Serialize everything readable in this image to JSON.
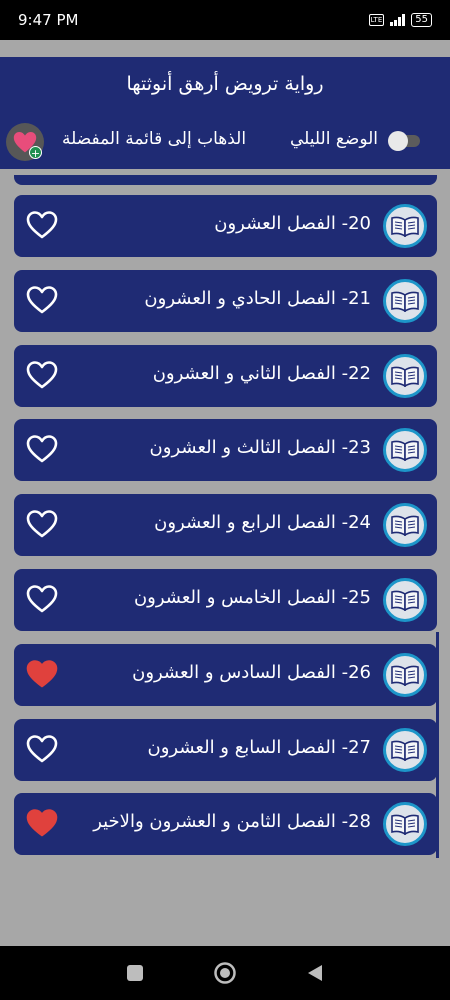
{
  "status_bar": {
    "time": "9:47 PM",
    "battery": "55",
    "network": "LTE"
  },
  "header": {
    "title": "رواية ترويض أرهق أنوثتها",
    "night_mode_label": "الوضع الليلي",
    "favorites_label": "الذهاب إلى قائمة المفضلة",
    "night_mode_on": false
  },
  "chapters": [
    {
      "label": "20- الفصل العشرون",
      "favorite": false
    },
    {
      "label": "21- الفصل الحادي و العشرون",
      "favorite": false
    },
    {
      "label": "22- الفصل الثاني و العشرون",
      "favorite": false
    },
    {
      "label": "23- الفصل الثالث و العشرون",
      "favorite": false
    },
    {
      "label": "24- الفصل الرابع و العشرون",
      "favorite": false
    },
    {
      "label": "25- الفصل الخامس و العشرون",
      "favorite": false
    },
    {
      "label": "26- الفصل السادس و العشرون",
      "favorite": true
    },
    {
      "label": "27- الفصل السابع و العشرون",
      "favorite": false
    },
    {
      "label": "28- الفصل الثامن و العشرون والاخير",
      "favorite": true
    }
  ],
  "colors": {
    "primary": "#1f2b74",
    "heart_active": "#e0413d",
    "heart_inactive": "#ffffff",
    "book_ring": "#1d96c9"
  },
  "icons": {
    "heart": "heart-icon",
    "book": "book-icon",
    "favorites": "favorites-heart-icon"
  }
}
